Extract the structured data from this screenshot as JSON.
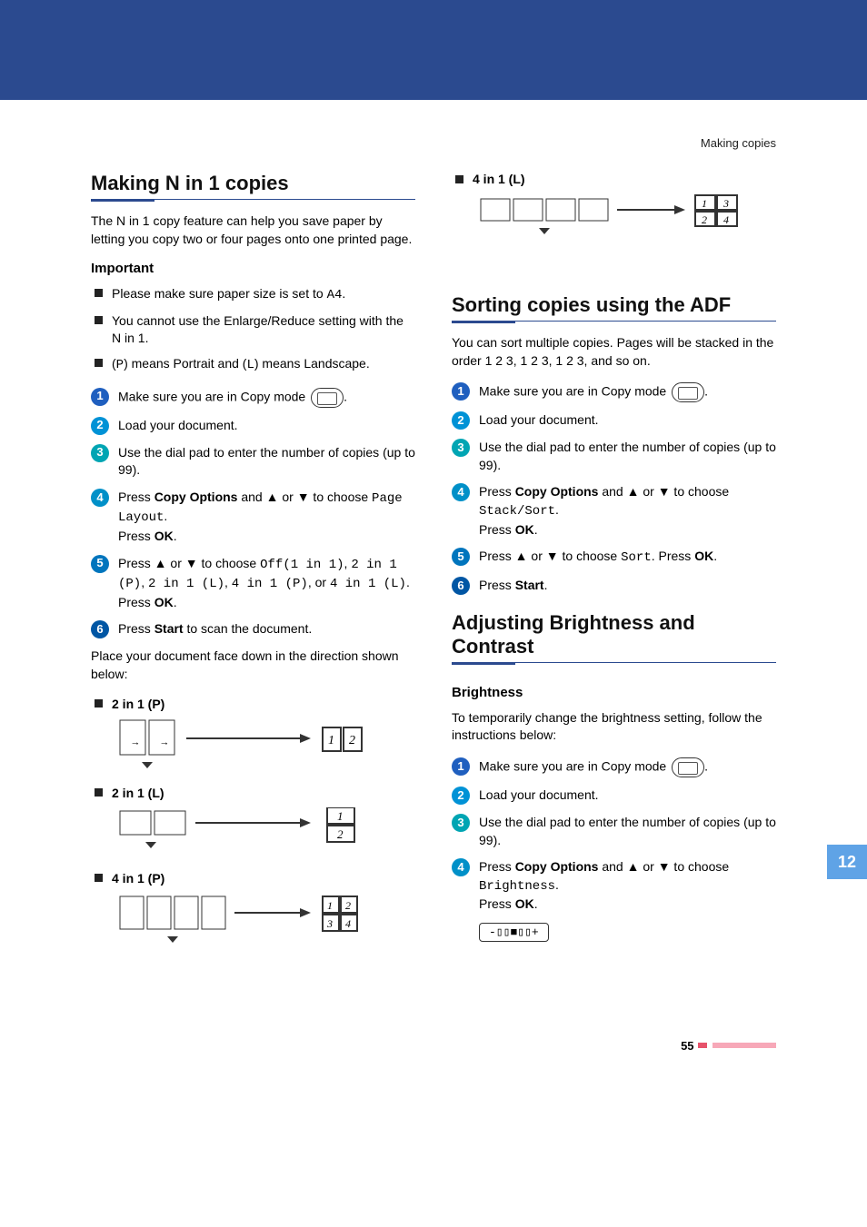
{
  "running_head": "Making copies",
  "left": {
    "h_n1": "Making N in 1 copies",
    "p_intro": "The N in 1 copy feature can help you save paper by letting you copy two or four pages onto one printed page.",
    "h_important": "Important",
    "bullets": {
      "b1_pre": "Please make sure paper size is set to ",
      "b1_code": "A4",
      "b1_post": ".",
      "b2": "You cannot use the Enlarge/Reduce setting with the N in 1.",
      "b3_pre": "(",
      "b3_c1": "P",
      "b3_mid": ") means Portrait and (",
      "b3_c2": "L",
      "b3_post": ") means Landscape."
    },
    "steps": {
      "s1": "Make sure you are in Copy mode ",
      "s2": "Load your document.",
      "s3": "Use the dial pad to enter the number of copies (up to 99).",
      "s4_pre": "Press ",
      "s4_b": "Copy Options",
      "s4_mid": " and ▲ or ▼ to choose ",
      "s4_code": "Page Layout",
      "s4_post": ".",
      "s4_ok_pre": "Press ",
      "s4_ok": "OK",
      "s4_ok_post": ".",
      "s5_pre": "Press ▲ or ▼ to choose ",
      "s5_c1": "Off(1 in 1)",
      "s5_c2": "2 in 1 (P)",
      "s5_c3": "2 in 1 (L)",
      "s5_c4": "4 in 1 (P)",
      "s5_or": ", or ",
      "s5_c5": "4 in 1 (L)",
      "s5_post": ".",
      "s5_ok_pre": "Press ",
      "s5_ok": "OK",
      "s5_ok_post": ".",
      "s6_pre": "Press ",
      "s6_b": "Start",
      "s6_post": " to scan the document."
    },
    "p_place": "Place your document face down in the direction shown below:",
    "layouts": {
      "l1": "2 in 1 (P)",
      "l2": "2 in 1 (L)",
      "l3": "4 in 1 (P)"
    }
  },
  "right": {
    "layout4l": "4 in 1 (L)",
    "h_sort": "Sorting copies using the ADF",
    "p_sort": "You can sort multiple copies. Pages will be stacked in the order 1 2 3, 1 2 3, 1 2 3, and so on.",
    "steps_sort": {
      "s1": "Make sure you are in Copy mode ",
      "s2": "Load your document.",
      "s3": "Use the dial pad to enter the number of copies (up to 99).",
      "s4_pre": "Press ",
      "s4_b": "Copy Options",
      "s4_mid": " and ▲ or ▼ to choose ",
      "s4_code": "Stack/Sort",
      "s4_post": ".",
      "s4_ok_pre": "Press ",
      "s4_ok": "OK",
      "s4_ok_post": ".",
      "s5_pre": "Press ▲ or ▼ to choose ",
      "s5_code": "Sort",
      "s5_mid": ". Press ",
      "s5_ok": "OK",
      "s5_post": ".",
      "s6_pre": "Press ",
      "s6_b": "Start",
      "s6_post": "."
    },
    "h_bright": "Adjusting Brightness and Contrast",
    "h_bright_sub": "Brightness",
    "p_bright": "To temporarily change the brightness setting, follow the instructions below:",
    "steps_b": {
      "s1": "Make sure you are in Copy mode ",
      "s2": "Load your document.",
      "s3": "Use the dial pad to enter the number of copies (up to 99).",
      "s4_pre": "Press ",
      "s4_b": "Copy Options",
      "s4_mid": " and ▲ or ▼ to choose ",
      "s4_code": "Brightness",
      "s4_post": ".",
      "s4_ok_pre": "Press ",
      "s4_ok": "OK",
      "s4_ok_post": "."
    },
    "lcd": "-▯▯■▯▯+"
  },
  "chapter_tab": "12",
  "page_number": "55"
}
